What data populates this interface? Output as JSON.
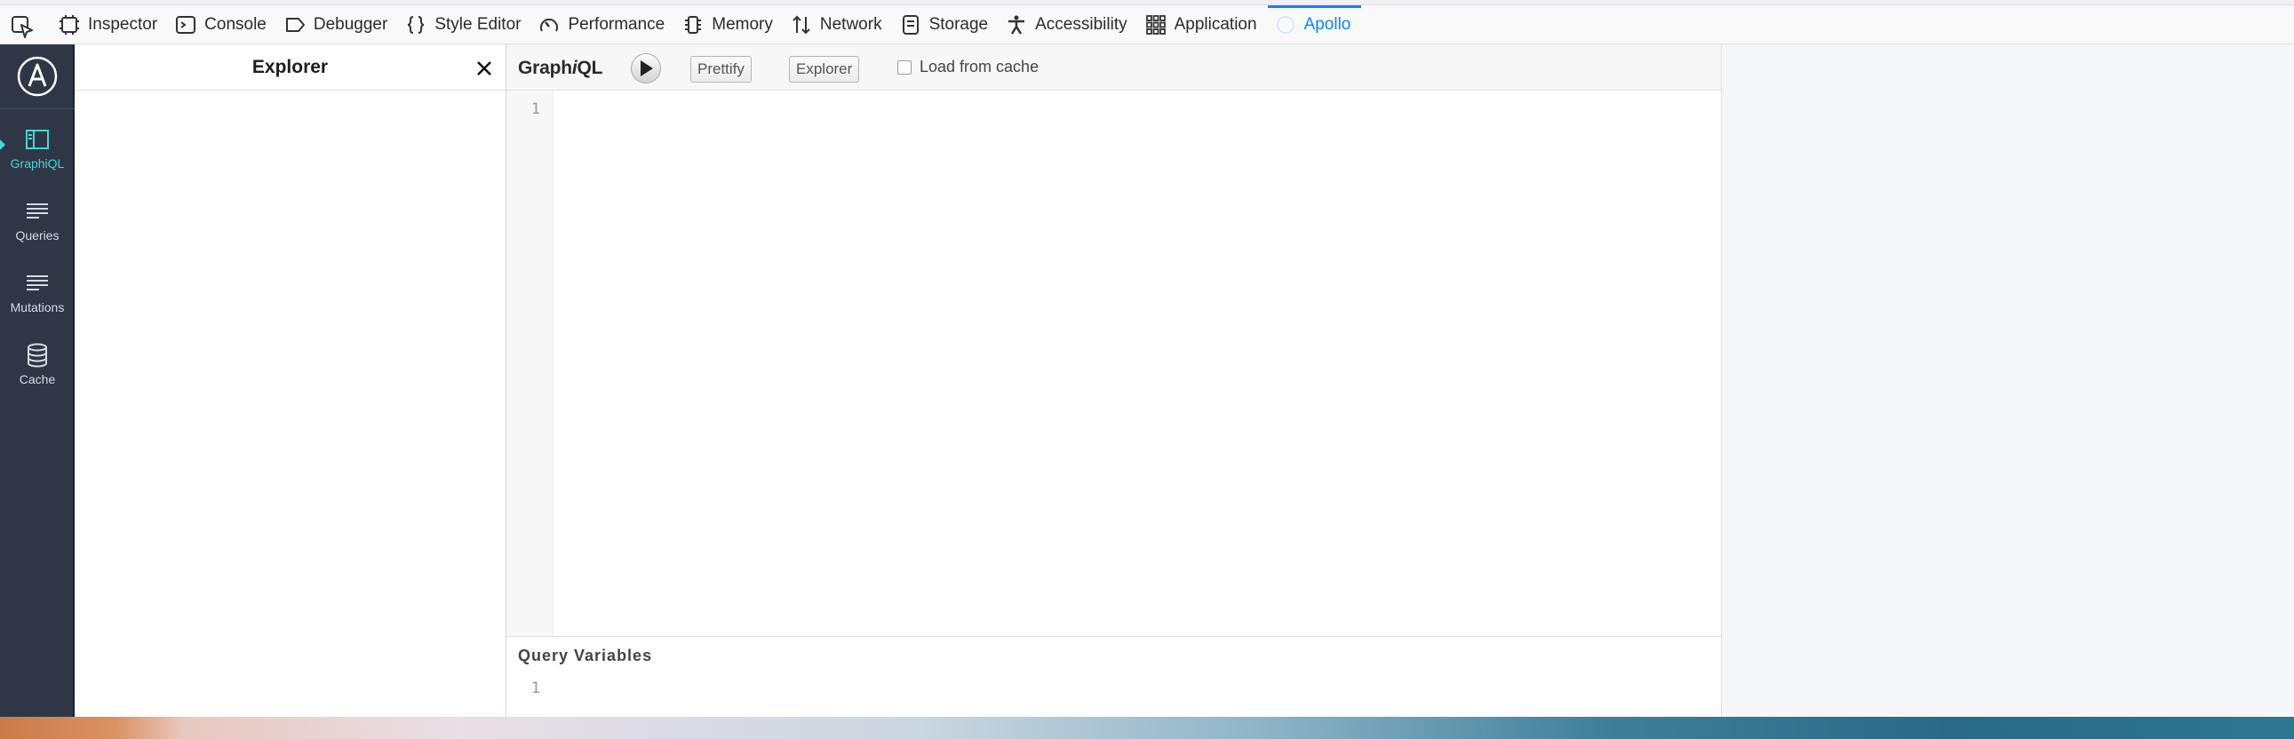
{
  "toolbar": {
    "tabs": [
      {
        "label": "Inspector",
        "icon": "inspector-icon"
      },
      {
        "label": "Console",
        "icon": "console-icon"
      },
      {
        "label": "Debugger",
        "icon": "debugger-icon"
      },
      {
        "label": "Style Editor",
        "icon": "braces-icon"
      },
      {
        "label": "Performance",
        "icon": "gauge-icon"
      },
      {
        "label": "Memory",
        "icon": "chip-icon"
      },
      {
        "label": "Network",
        "icon": "arrows-updown-icon"
      },
      {
        "label": "Storage",
        "icon": "storage-icon"
      },
      {
        "label": "Accessibility",
        "icon": "accessibility-icon"
      },
      {
        "label": "Application",
        "icon": "grid-icon"
      },
      {
        "label": "Apollo",
        "icon": "apollo-icon",
        "selected": true
      }
    ]
  },
  "sidebar": {
    "items": [
      {
        "label": "GraphiQL",
        "icon": "graphiql-icon",
        "active": true
      },
      {
        "label": "Queries",
        "icon": "list-icon"
      },
      {
        "label": "Mutations",
        "icon": "list-icon"
      },
      {
        "label": "Cache",
        "icon": "database-icon"
      }
    ]
  },
  "explorer": {
    "title": "Explorer"
  },
  "graphiql": {
    "title_prefix": "Graph",
    "title_i": "i",
    "title_suffix": "QL",
    "prettify_label": "Prettify",
    "explorer_label": "Explorer",
    "cache_label": "Load from cache",
    "cache_checked": false,
    "editor_line": "1",
    "variables_title": "Query Variables",
    "variables_line": "1"
  },
  "colors": {
    "accent": "#0a84ff",
    "apollo_teal": "#41d9d3",
    "rail_bg": "#2f3747"
  }
}
